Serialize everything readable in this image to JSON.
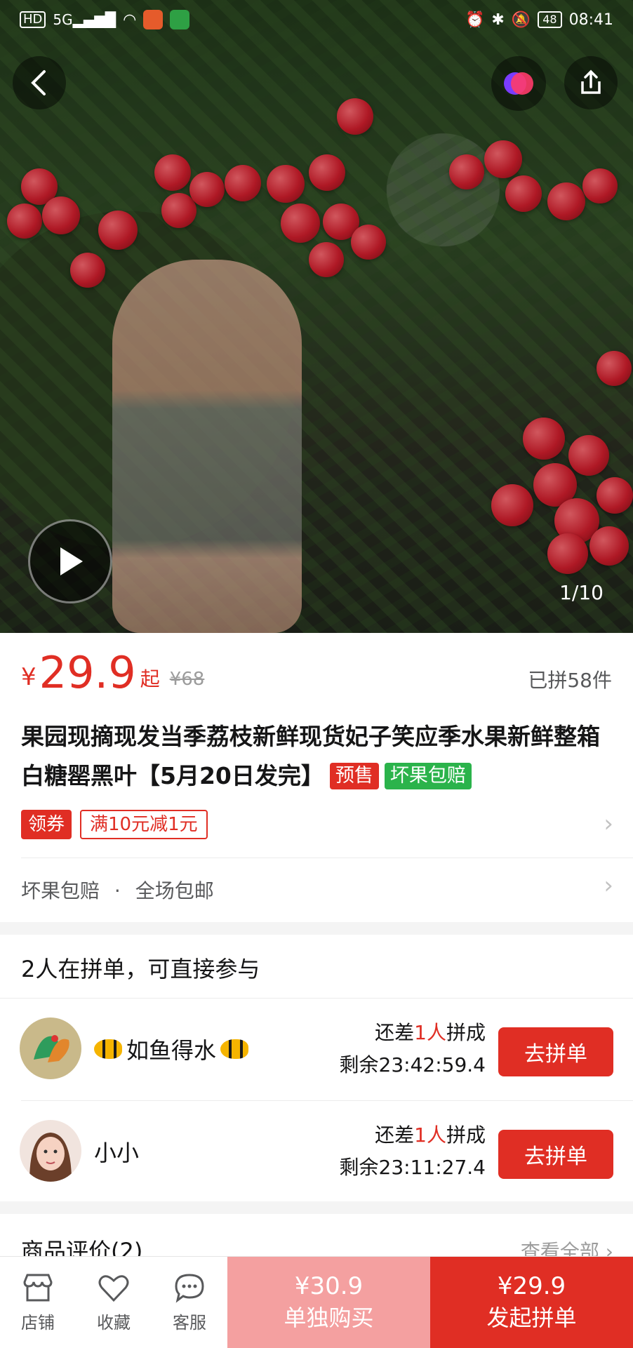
{
  "status_bar": {
    "left_icons": [
      "hd-icon",
      "5g-signal-icon",
      "wifi-icon"
    ],
    "time": "08:41",
    "battery": "48"
  },
  "gallery": {
    "counter": "1/10"
  },
  "product": {
    "currency": "¥",
    "price": "29.9",
    "price_suffix": "起",
    "original_price": "¥68",
    "sold": "已拼58件",
    "title": "果园现摘现发当季荔枝新鲜现货妃子笑应季水果新鲜整箱白糖罂黑叶【5月20日发完】",
    "tag_presale": "预售",
    "tag_guarantee": "坏果包赔",
    "coupon_label": "领券",
    "coupon_value": "满10元减1元",
    "service_1": "坏果包赔",
    "service_sep": "·",
    "service_2": "全场包邮"
  },
  "group_buy": {
    "header": "2人在拼单，可直接参与",
    "rows": [
      {
        "name": "如鱼得水",
        "need_prefix": "还差",
        "need_count": "1人",
        "need_suffix": "拼成",
        "remaining": "剩余23:42:59.4",
        "button": "去拼单"
      },
      {
        "name": "小小",
        "need_prefix": "还差",
        "need_count": "1人",
        "need_suffix": "拼成",
        "remaining": "剩余23:11:27.4",
        "button": "去拼单"
      }
    ]
  },
  "reviews": {
    "title": "商品评价(2)",
    "view_all": "查看全部"
  },
  "bottom_bar": {
    "store": "店铺",
    "favorite": "收藏",
    "service": "客服",
    "single_price": "¥30.9",
    "single_label": "单独购买",
    "group_price": "¥29.9",
    "group_label": "发起拼单"
  },
  "colors": {
    "accent": "#e02e24",
    "green_tag": "#2bb34b",
    "single_buy_bg": "#f4a0a0"
  }
}
